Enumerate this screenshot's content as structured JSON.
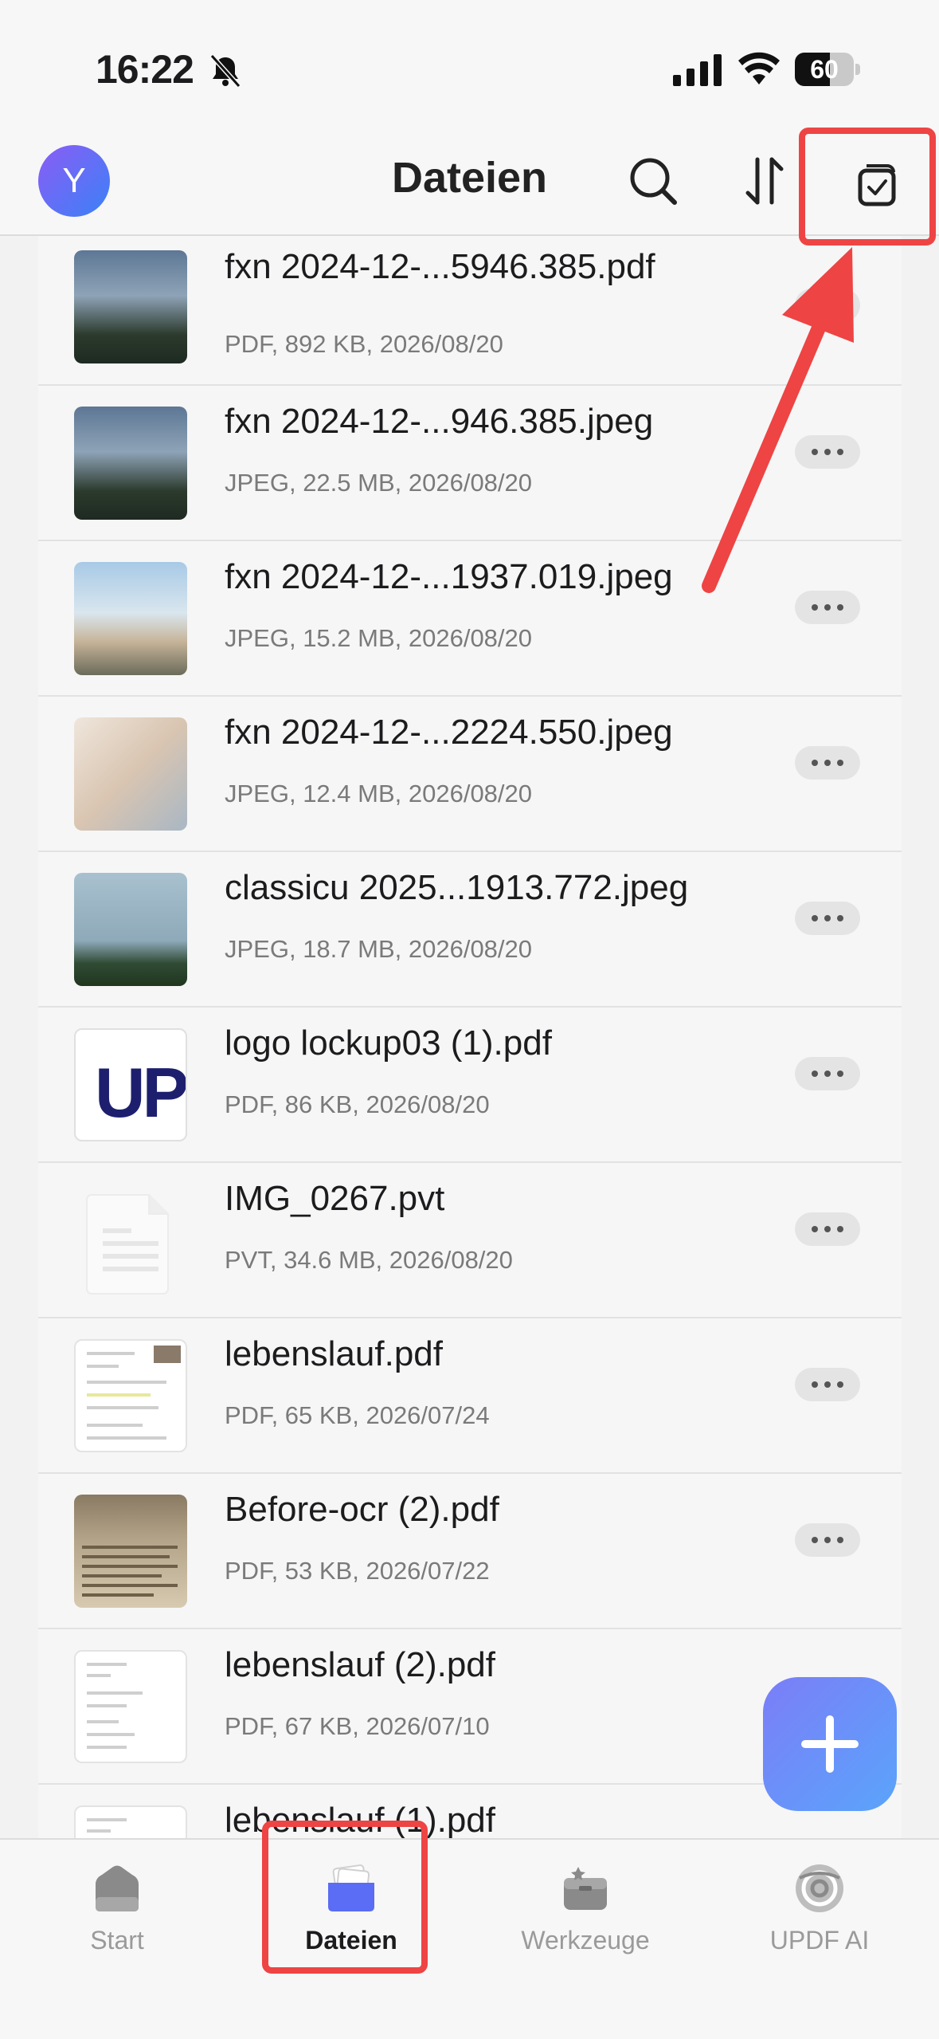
{
  "status_bar": {
    "time": "16:22",
    "battery_level": 60,
    "battery_label": "60",
    "icons": [
      "bell-slash-icon",
      "signal-icon",
      "wifi-icon",
      "battery-icon"
    ]
  },
  "header": {
    "avatar_initial": "Y",
    "title": "Dateien",
    "icons": [
      "search-icon",
      "sort-icon",
      "select-icon"
    ]
  },
  "files": [
    {
      "name": " fxn 2024-12-...5946.385.pdf",
      "meta": "PDF, 892 KB, 2026/08/20",
      "thumb": "photo-night-pier"
    },
    {
      "name": " fxn 2024-12-...946.385.jpeg",
      "meta": "JPEG, 22.5 MB, 2026/08/20",
      "thumb": "photo-night-pier"
    },
    {
      "name": " fxn 2024-12-...1937.019.jpeg",
      "meta": "JPEG, 15.2 MB, 2026/08/20",
      "thumb": "photo-buildings"
    },
    {
      "name": "fxn 2024-12-...2224.550.jpeg",
      "meta": "JPEG, 12.4 MB, 2026/08/20",
      "thumb": "photo-shop"
    },
    {
      "name": " classicu 2025...1913.772.jpeg",
      "meta": "JPEG, 18.7 MB, 2026/08/20",
      "thumb": "photo-sea"
    },
    {
      "name": "logo lockup03 (1).pdf",
      "meta": "PDF, 86 KB, 2026/08/20",
      "thumb": "logo"
    },
    {
      "name": "IMG_0267.pvt",
      "meta": "PVT, 34.6 MB, 2026/08/20",
      "thumb": "blank-document"
    },
    {
      "name": "lebenslauf.pdf",
      "meta": "PDF, 65 KB, 2026/07/24",
      "thumb": "document"
    },
    {
      "name": "Before-ocr (2).pdf",
      "meta": "PDF, 53 KB, 2026/07/22",
      "thumb": "scanned-newspaper"
    },
    {
      "name": "lebenslauf (2).pdf",
      "meta": "PDF, 67 KB, 2026/07/10",
      "thumb": "document"
    },
    {
      "name": "lebenslauf (1).pdf",
      "meta": "",
      "thumb": "document"
    }
  ],
  "logo_thumb_text": "UP",
  "fab": {
    "icon": "plus-icon"
  },
  "tabs": [
    {
      "label": "Start",
      "icon": "home-icon",
      "active": false
    },
    {
      "label": "Dateien",
      "icon": "folder-icon",
      "active": true
    },
    {
      "label": "Werkzeuge",
      "icon": "toolbox-icon",
      "active": false
    },
    {
      "label": "UPDF AI",
      "icon": "ai-icon",
      "active": false
    }
  ],
  "colors": {
    "accent": "#6b7cf7",
    "annotation_red": "#ee4444",
    "background": "#f2f2f2",
    "row_background": "#f6f6f6"
  }
}
